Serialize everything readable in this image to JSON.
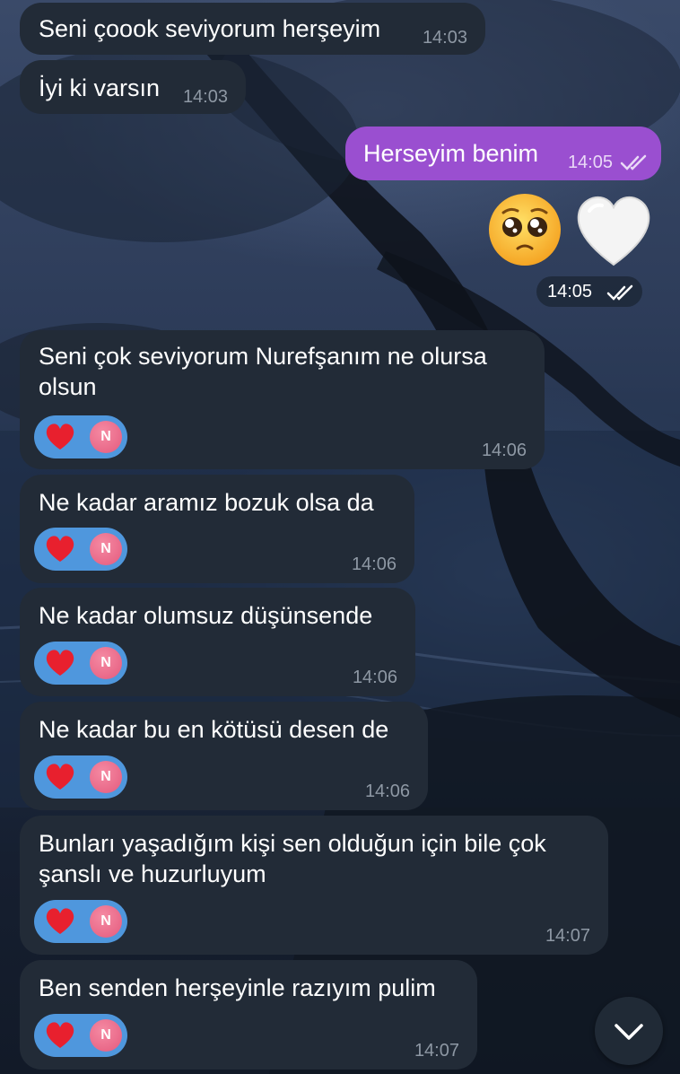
{
  "messages": [
    {
      "type": "incoming",
      "text": "Seni çoook seviyorum herşeyim",
      "time": "14:03"
    },
    {
      "type": "incoming",
      "text": "İyi ki varsın",
      "time": "14:03"
    },
    {
      "type": "outgoing",
      "text": "Herseyim benim",
      "time": "14:05",
      "status": "read"
    },
    {
      "type": "sticker",
      "stickers": [
        "pleading-face",
        "white-heart"
      ],
      "time": "14:05",
      "status": "read"
    },
    {
      "type": "incoming",
      "text": "Seni çok seviyorum Nurefşanım ne olursa\nolsun",
      "time": "14:06",
      "reaction": {
        "emoji": "heart",
        "avatar": "N"
      }
    },
    {
      "type": "incoming",
      "text": "Ne kadar aramız bozuk olsa da",
      "time": "14:06",
      "reaction": {
        "emoji": "heart",
        "avatar": "N"
      }
    },
    {
      "type": "incoming",
      "text": "Ne kadar olumsuz düşünsende",
      "time": "14:06",
      "reaction": {
        "emoji": "heart",
        "avatar": "N"
      }
    },
    {
      "type": "incoming",
      "text": "Ne kadar bu en kötüsü desen de",
      "time": "14:06",
      "reaction": {
        "emoji": "heart",
        "avatar": "N"
      }
    },
    {
      "type": "incoming",
      "text": "Bunları yaşadığım kişi sen olduğun için bile çok\nşanslı ve huzurluyum",
      "time": "14:07",
      "reaction": {
        "emoji": "heart",
        "avatar": "N"
      }
    },
    {
      "type": "incoming",
      "text": "Ben senden herşeyinle razıyım pulim",
      "time": "14:07",
      "reaction": {
        "emoji": "heart",
        "avatar": "N"
      }
    }
  ],
  "colors": {
    "incoming_bubble": "#222b37",
    "outgoing_bubble": "#9a4fd0",
    "reaction": "#4f97dd",
    "avatar": "#e45a7d"
  },
  "scroll_button": {
    "icon": "chevron-down-icon"
  }
}
